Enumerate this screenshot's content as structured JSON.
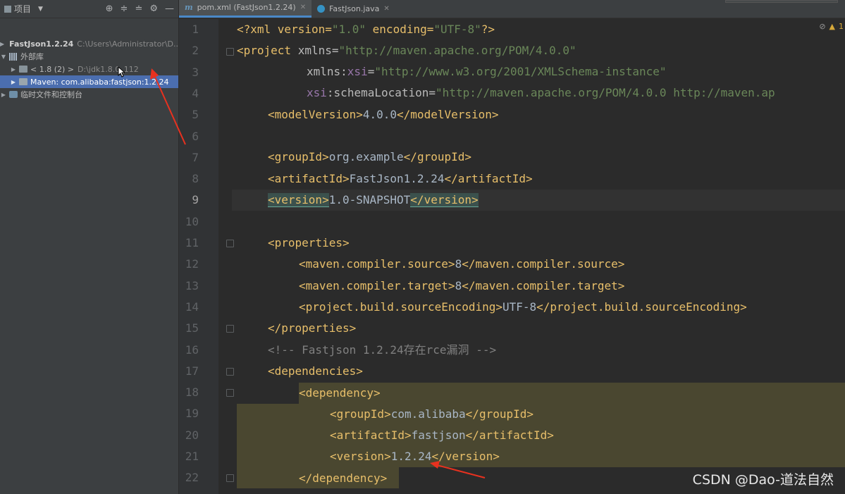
{
  "project_panel": {
    "title": "项目",
    "tree": [
      {
        "label": "FastJson1.2.24",
        "path": "C:\\Users\\Administrator\\D..."
      },
      {
        "label": "外部库"
      },
      {
        "label": "< 1.8 (2) >",
        "path": "D:\\jdk1.8.0_112"
      },
      {
        "label": "Maven: com.alibaba:fastjson:1.2.24"
      },
      {
        "label": "临时文件和控制台"
      }
    ]
  },
  "tabs": [
    {
      "label": "pom.xml (FastJson1.2.24)",
      "icon": "m",
      "active": true
    },
    {
      "label": "FastJson.java",
      "icon": "c",
      "active": false
    }
  ],
  "editor": {
    "line_numbers": [
      "1",
      "2",
      "3",
      "4",
      "5",
      "6",
      "7",
      "8",
      "9",
      "10",
      "11",
      "12",
      "13",
      "14",
      "15",
      "16",
      "17",
      "18",
      "19",
      "20",
      "21",
      "22"
    ],
    "current_line": "9",
    "indicator": "1"
  },
  "code": {
    "l1": {
      "a": "<?xml version=",
      "b": "\"1.0\"",
      "c": " encoding=",
      "d": "\"UTF-8\"",
      "e": "?>"
    },
    "l2": {
      "a": "<project ",
      "b": "xmlns=",
      "c": "\"http://maven.apache.org/POM/4.0.0\""
    },
    "l3": {
      "a": "xmlns:",
      "b": "xsi",
      "c": "=",
      "d": "\"http://www.w3.org/2001/XMLSchema-instance\""
    },
    "l4": {
      "a": "xsi",
      ":": ":",
      "b": "schemaLocation=",
      "c": "\"http://maven.apache.org/POM/4.0.0 http://maven.ap"
    },
    "l5": {
      "a": "<modelVersion>",
      "b": "4.0.0",
      "c": "</modelVersion>"
    },
    "l7": {
      "a": "<groupId>",
      "b": "org.example",
      "c": "</groupId>"
    },
    "l8": {
      "a": "<artifactId>",
      "b": "FastJson1.2.24",
      "c": "</artifactId>"
    },
    "l9": {
      "a": "<version>",
      "b": "1.0-SNAPSHOT",
      "c": "</version>"
    },
    "l11": {
      "a": "<properties>"
    },
    "l12": {
      "a": "<maven.compiler.source>",
      "b": "8",
      "c": "</maven.compiler.source>"
    },
    "l13": {
      "a": "<maven.compiler.target>",
      "b": "8",
      "c": "</maven.compiler.target>"
    },
    "l14": {
      "a": "<project.build.sourceEncoding>",
      "b": "UTF-8",
      "c": "</project.build.sourceEncoding>"
    },
    "l15": {
      "a": "</properties>"
    },
    "l16": {
      "a": "<!-- Fastjson 1.2.24存在rce漏洞 -->"
    },
    "l17": {
      "a": "<dependencies>"
    },
    "l18": {
      "a": "<dependency>"
    },
    "l19": {
      "a": "<groupId>",
      "b": "com.alibaba",
      "c": "</groupId>"
    },
    "l20": {
      "a": "<artifactId>",
      "b": "fastjson",
      "c": "</artifactId>"
    },
    "l21": {
      "a": "<version>",
      "b": "1.2.24",
      "c": "</version>"
    },
    "l22": {
      "a": "</dependency>"
    }
  },
  "watermark": "CSDN @Dao-道法自然",
  "colors": {
    "selection": "#4b6eaf",
    "tag": "#e8bf6a",
    "string": "#6a8759",
    "annotation_arrow": "#e8311f"
  }
}
